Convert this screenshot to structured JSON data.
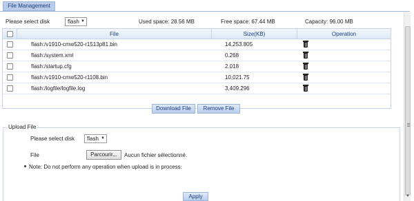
{
  "tab": {
    "label": "File Management"
  },
  "disk_row": {
    "label": "Please select disk",
    "disk_value": "flash",
    "used_space": "Used space: 28.56 MB",
    "free_space": "Free space: 67.44 MB",
    "capacity": "Capacity: 96.00 MB"
  },
  "table": {
    "headers": {
      "file": "File",
      "size": "Size(KB)",
      "operation": "Operation"
    },
    "rows": [
      {
        "file": "flash:/v1910-cmw520-r1513p81.bin",
        "size": "14,253.805"
      },
      {
        "file": "flash:/system.xml",
        "size": "0.268"
      },
      {
        "file": "flash:/startup.cfg",
        "size": "2.018"
      },
      {
        "file": "flash:/v1910-cmw520-r1108.bin",
        "size": "10,021.75"
      },
      {
        "file": "flash:/logfile/logfile.log",
        "size": "3,409.296"
      }
    ]
  },
  "buttons": {
    "download": "Download File",
    "remove": "Remove File",
    "apply": "Apply"
  },
  "upload": {
    "legend": "Upload File",
    "disk_label": "Please select disk",
    "disk_value": "flash",
    "file_label": "File",
    "browse_label": "Parcourir...",
    "no_file_text": "Aucun fichier sélectionné.",
    "note": "Note: Do not perform any operation when upload is in process."
  },
  "icons": {
    "delete": "trash-icon",
    "dropdown": "chevron-down-icon"
  }
}
